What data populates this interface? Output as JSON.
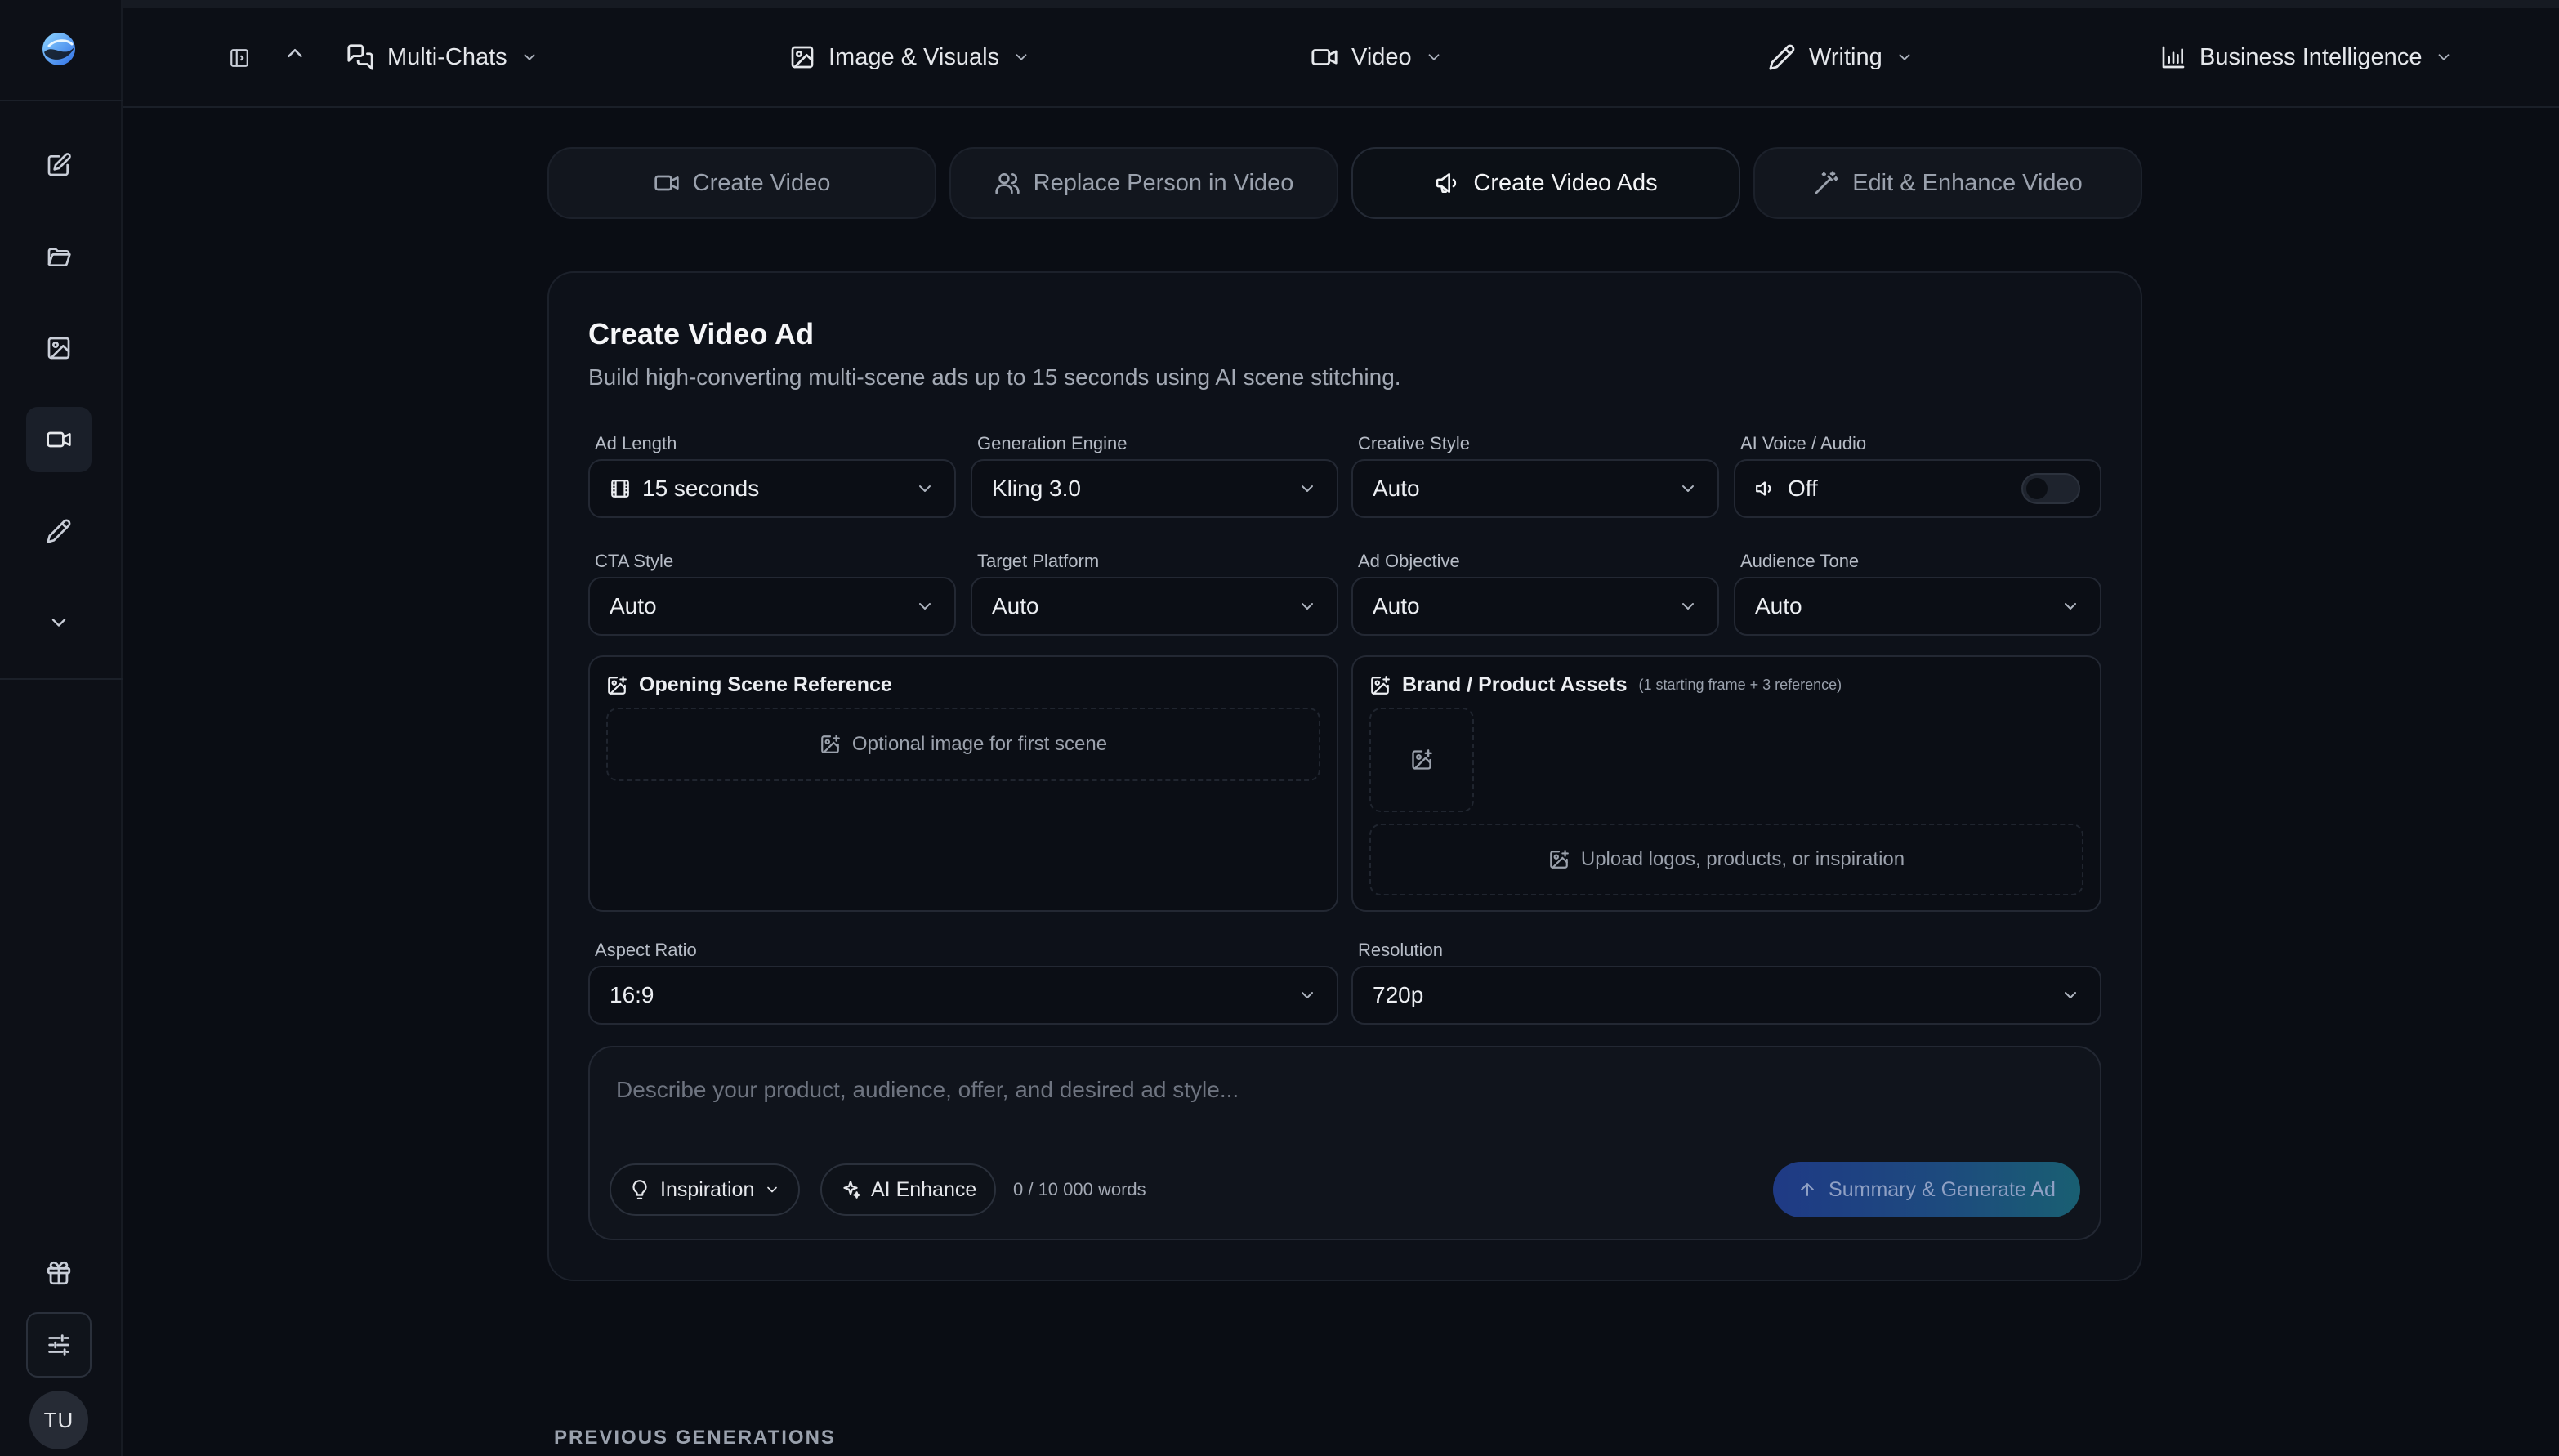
{
  "nav": {
    "menus": [
      {
        "label": "Multi-Chats",
        "icon": "chats-icon"
      },
      {
        "label": "Image & Visuals",
        "icon": "image-icon"
      },
      {
        "label": "Video",
        "icon": "video-icon"
      },
      {
        "label": "Writing",
        "icon": "pen-icon"
      },
      {
        "label": "Business Intelligence",
        "icon": "bar-chart-icon"
      }
    ]
  },
  "sidebar": {
    "items": [
      "new-chat-icon",
      "folder-icon",
      "image-icon",
      "video-icon",
      "pen-icon",
      "chevron-down-icon"
    ],
    "active_item": "video-icon",
    "avatar_initials": "TU"
  },
  "tabs": [
    {
      "label": "Create Video",
      "icon": "video-icon",
      "active": false
    },
    {
      "label": "Replace Person in Video",
      "icon": "users-icon",
      "active": false
    },
    {
      "label": "Create Video Ads",
      "icon": "megaphone-icon",
      "active": true
    },
    {
      "label": "Edit & Enhance Video",
      "icon": "magic-wand-icon",
      "active": false
    }
  ],
  "form": {
    "title": "Create Video Ad",
    "subtitle": "Build high-converting multi-scene ads up to 15 seconds using AI scene stitching.",
    "ad_length": {
      "label": "Ad Length",
      "value": "15 seconds"
    },
    "engine": {
      "label": "Generation Engine",
      "value": "Kling 3.0"
    },
    "creative_style": {
      "label": "Creative Style",
      "value": "Auto"
    },
    "voice": {
      "label": "AI Voice / Audio",
      "value": "Off",
      "enabled": false
    },
    "cta_style": {
      "label": "CTA Style",
      "value": "Auto"
    },
    "target_platform": {
      "label": "Target Platform",
      "value": "Auto"
    },
    "ad_objective": {
      "label": "Ad Objective",
      "value": "Auto"
    },
    "audience_tone": {
      "label": "Audience Tone",
      "value": "Auto"
    },
    "opening_scene": {
      "title": "Opening Scene Reference",
      "drop_text": "Optional image for first scene"
    },
    "brand_assets": {
      "title": "Brand / Product Assets",
      "note": "(1 starting frame + 3 reference)",
      "drop_text": "Upload logos, products, or inspiration"
    },
    "aspect_ratio": {
      "label": "Aspect Ratio",
      "value": "16:9"
    },
    "resolution": {
      "label": "Resolution",
      "value": "720p"
    }
  },
  "composer": {
    "placeholder": "Describe your product, audience, offer, and desired ad style...",
    "inspiration_label": "Inspiration",
    "enhance_label": "AI Enhance",
    "word_count": "0 / 10 000 words",
    "generate_label": "Summary & Generate Ad"
  },
  "section": {
    "previous_generations": "PREVIOUS GENERATIONS"
  }
}
